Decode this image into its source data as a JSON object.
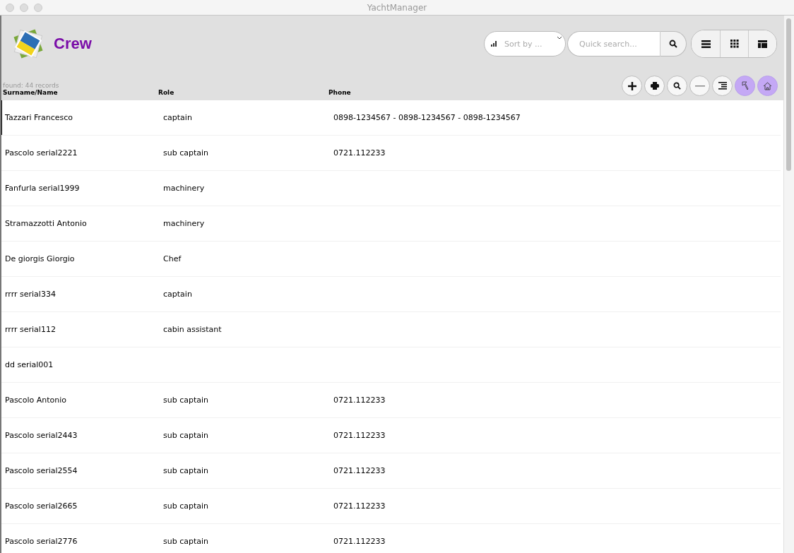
{
  "window": {
    "title": "YachtManager"
  },
  "header": {
    "title": "Crew",
    "sort": {
      "placeholder": "Sort by ..."
    },
    "search": {
      "placeholder": "Quick search..."
    },
    "view_modes": [
      {
        "kind": "list",
        "selected": false
      },
      {
        "kind": "grid",
        "selected": false
      },
      {
        "kind": "table",
        "selected": false
      }
    ],
    "record_count": "found: 44 records",
    "actions": [
      {
        "kind": "add",
        "highlighted": false
      },
      {
        "kind": "print",
        "highlighted": false
      },
      {
        "kind": "find",
        "highlighted": false
      },
      {
        "kind": "remove",
        "highlighted": false
      },
      {
        "kind": "align",
        "highlighted": false
      },
      {
        "kind": "back",
        "highlighted": true
      },
      {
        "kind": "home",
        "highlighted": true
      }
    ]
  },
  "table": {
    "columns": [
      "Surname/Name",
      "Role",
      "Phone"
    ],
    "rows": [
      {
        "cells": [
          "Tazzari Francesco",
          "captain",
          "0898-1234567 - 0898-1234567 - 0898-1234567"
        ],
        "selected": true
      },
      {
        "cells": [
          "Pascolo serial2221",
          "sub captain",
          "0721.112233"
        ],
        "selected": false
      },
      {
        "cells": [
          "Fanfurla serial1999",
          "machinery",
          ""
        ],
        "selected": false
      },
      {
        "cells": [
          "Stramazzotti Antonio",
          "machinery",
          ""
        ],
        "selected": false
      },
      {
        "cells": [
          "De giorgis Giorgio",
          "Chef",
          ""
        ],
        "selected": false
      },
      {
        "cells": [
          "rrrr serial334",
          "captain",
          ""
        ],
        "selected": false
      },
      {
        "cells": [
          "rrrr serial112",
          "cabin assistant",
          ""
        ],
        "selected": false
      },
      {
        "cells": [
          "dd serial001",
          "",
          ""
        ],
        "selected": false
      },
      {
        "cells": [
          "Pascolo Antonio",
          "sub captain",
          "0721.112233"
        ],
        "selected": false
      },
      {
        "cells": [
          "Pascolo serial2443",
          "sub captain",
          "0721.112233"
        ],
        "selected": false
      },
      {
        "cells": [
          "Pascolo serial2554",
          "sub captain",
          "0721.112233"
        ],
        "selected": false
      },
      {
        "cells": [
          "Pascolo serial2665",
          "sub captain",
          "0721.112233"
        ],
        "selected": false
      },
      {
        "cells": [
          "Pascolo serial2776",
          "sub captain",
          "0721.112233"
        ],
        "selected": false
      }
    ]
  }
}
